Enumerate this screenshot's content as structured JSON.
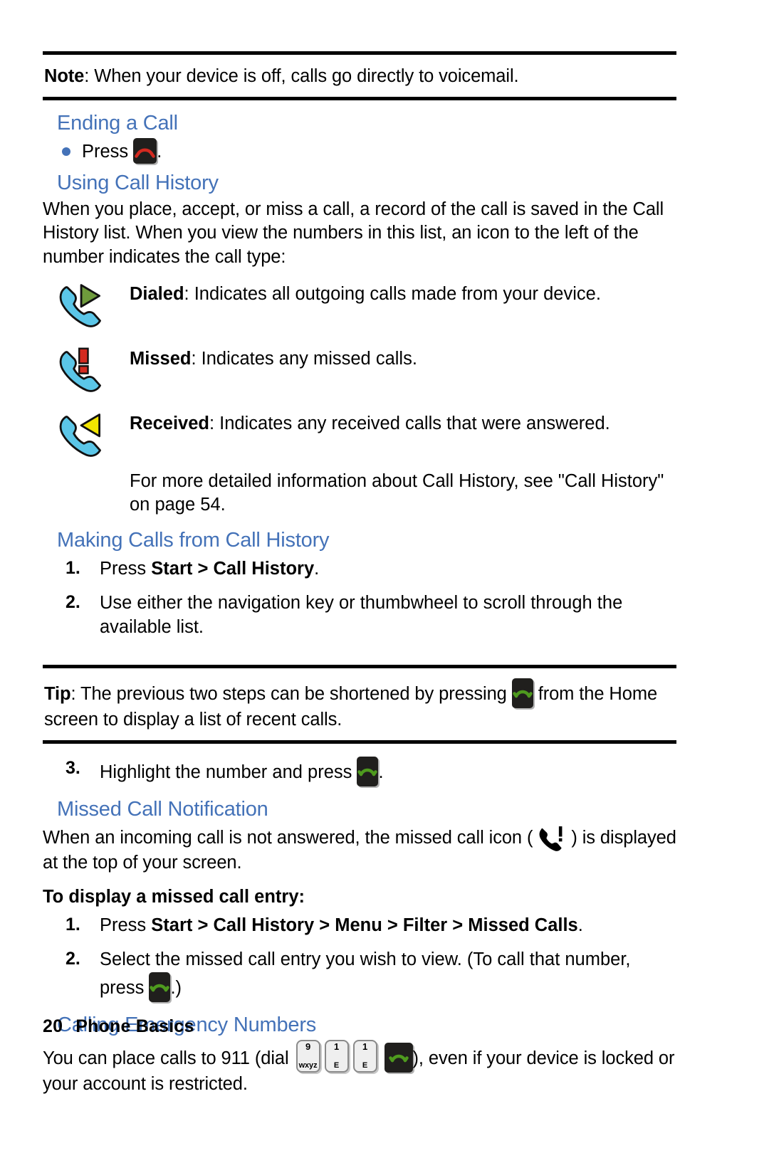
{
  "colors": {
    "heading_blue": "#4472B8",
    "bullet_blue": "#4472B8",
    "handset_blue": "#5BC6E8",
    "dialed_green": "#6E9B3C",
    "missed_red": "#D42A20",
    "received_yellow": "#F2E500",
    "key_black": "#201F1D",
    "end_arc_red": "#D42A20",
    "send_arc_green": "#4E9A1E",
    "key_gray": "#EFEFEF"
  },
  "note_callout": {
    "label": "Note",
    "text": ": When your device is off, calls go directly to voicemail."
  },
  "ending_a_call": {
    "heading": "Ending a Call",
    "bullet_prefix": "Press",
    "bullet_suffix": ".",
    "key_icon": "end-call-key-icon"
  },
  "using_call_history": {
    "heading": "Using Call History",
    "paragraph": "When you place, accept, or miss a call, a record of the call is saved in the Call History list. When you view the numbers in this list, an icon to the left of the number indicates the call type:",
    "icon_rows": [
      {
        "icon": "dialed-call-icon",
        "term": "Dialed",
        "text": ": Indicates all outgoing calls made from your device."
      },
      {
        "icon": "missed-call-icon",
        "term": "Missed",
        "text": ": Indicates any missed calls."
      },
      {
        "icon": "received-call-icon",
        "term": "Received",
        "text": ": Indicates any received calls that were answered."
      }
    ],
    "followup": "For more detailed information about Call History, see \"Call History\" on page 54."
  },
  "making_calls": {
    "heading": "Making Calls from Call History",
    "steps": [
      {
        "num": "1.",
        "pre": "Press ",
        "bold": "Start > Call History",
        "post": "."
      },
      {
        "num": "2.",
        "pre": "Use either the navigation key or thumbwheel to scroll through the available list.",
        "bold": "",
        "post": ""
      }
    ]
  },
  "tip_callout": {
    "label": "Tip",
    "text_before": ": The previous two steps can be shortened by pressing ",
    "text_after": " from the Home screen to display a list of recent calls.",
    "key_icon": "send-call-key-icon"
  },
  "step_three": {
    "num": "3.",
    "text_before": "Highlight the number and press ",
    "text_after": ".",
    "key_icon": "send-call-key-icon"
  },
  "missed_call_notification": {
    "heading": "Missed Call Notification",
    "text_before": "When an incoming call is not answered, the missed call icon ( ",
    "inline_icon": "missed-call-inline-icon",
    "text_after": " ) is displayed at the top of your screen.",
    "subheading": "To display a missed call entry:",
    "steps": [
      {
        "num": "1.",
        "pre": "Press ",
        "bold": "Start > Call History > Menu > Filter > Missed Calls",
        "post": "."
      },
      {
        "num": "2.",
        "pre": "Select the missed call entry you wish to view. (To call that number, press ",
        "bold": "",
        "post": ".)",
        "key_icon": "send-call-key-icon"
      }
    ]
  },
  "calling_emergency": {
    "heading": "Calling Emergency Numbers",
    "text_before": "You can place calls to 911 (dial ",
    "keys": [
      {
        "digit": "9",
        "letters": "W̲X̲Y̲Z̲",
        "label": "9",
        "sub": "wxyz"
      },
      {
        "digit": "1",
        "digit_small": "1",
        "sub": "E"
      },
      {
        "digit": "1",
        "digit_small": "1",
        "sub": "E"
      }
    ],
    "send_key_icon": "send-call-key-icon",
    "text_after": "), even if your device is locked or your account is restricted."
  },
  "footer": {
    "page_number": "20",
    "section": "Phone Basics"
  }
}
